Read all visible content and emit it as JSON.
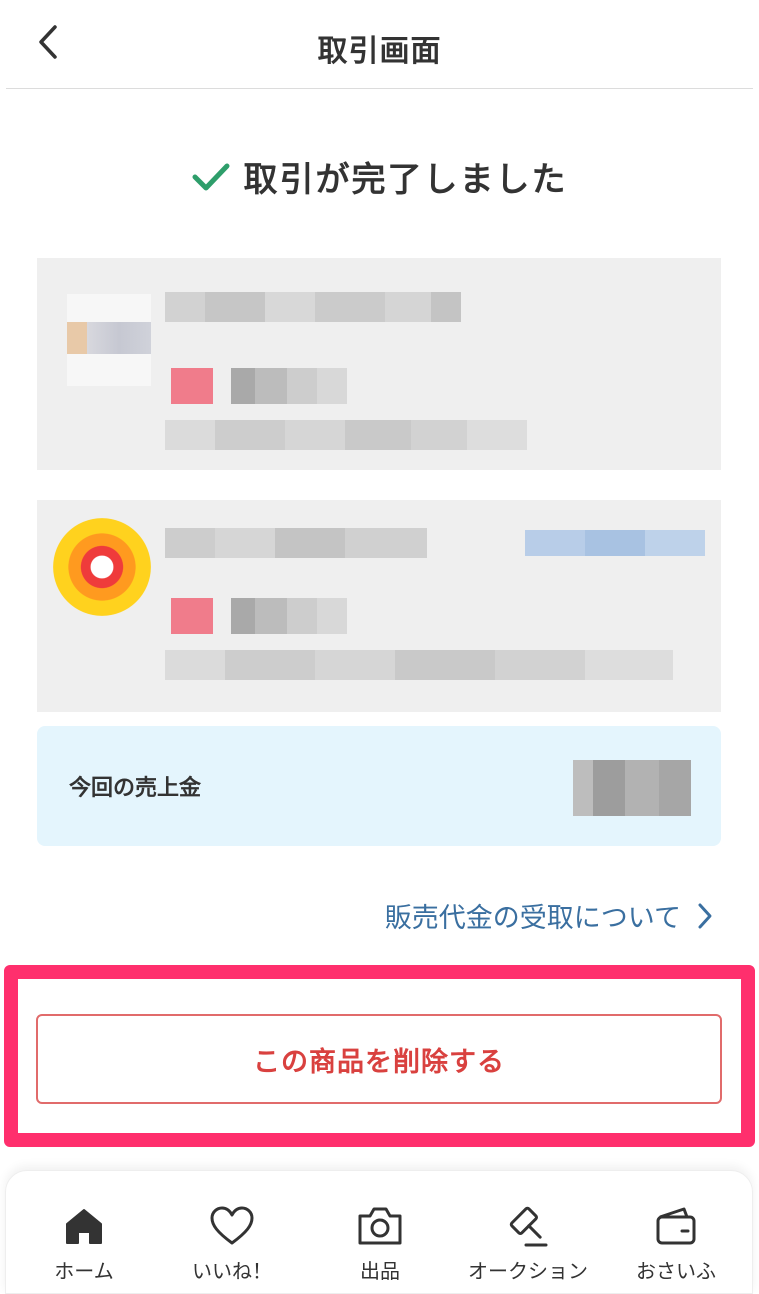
{
  "header": {
    "title": "取引画面",
    "back_icon": "chevron-left-icon"
  },
  "status": {
    "message": "取引が完了しました",
    "icon": "check-icon",
    "icon_color": "#2e9e6b"
  },
  "sales": {
    "label": "今回の売上金"
  },
  "payout_link": {
    "label": "販売代金の受取について",
    "icon": "chevron-right-icon",
    "color": "#3a6fa0"
  },
  "delete_button": {
    "label": "この商品を削除する",
    "color": "#d9413f",
    "highlight_color": "#ff2f6d"
  },
  "tabbar": {
    "items": [
      {
        "label": "ホーム",
        "icon": "home-icon",
        "active": true
      },
      {
        "label": "いいね！",
        "icon": "heart-icon",
        "active": false
      },
      {
        "label": "出品",
        "icon": "camera-icon",
        "active": false
      },
      {
        "label": "オークション",
        "icon": "gavel-icon",
        "active": false
      },
      {
        "label": "おさいふ",
        "icon": "wallet-icon",
        "active": false
      }
    ]
  }
}
